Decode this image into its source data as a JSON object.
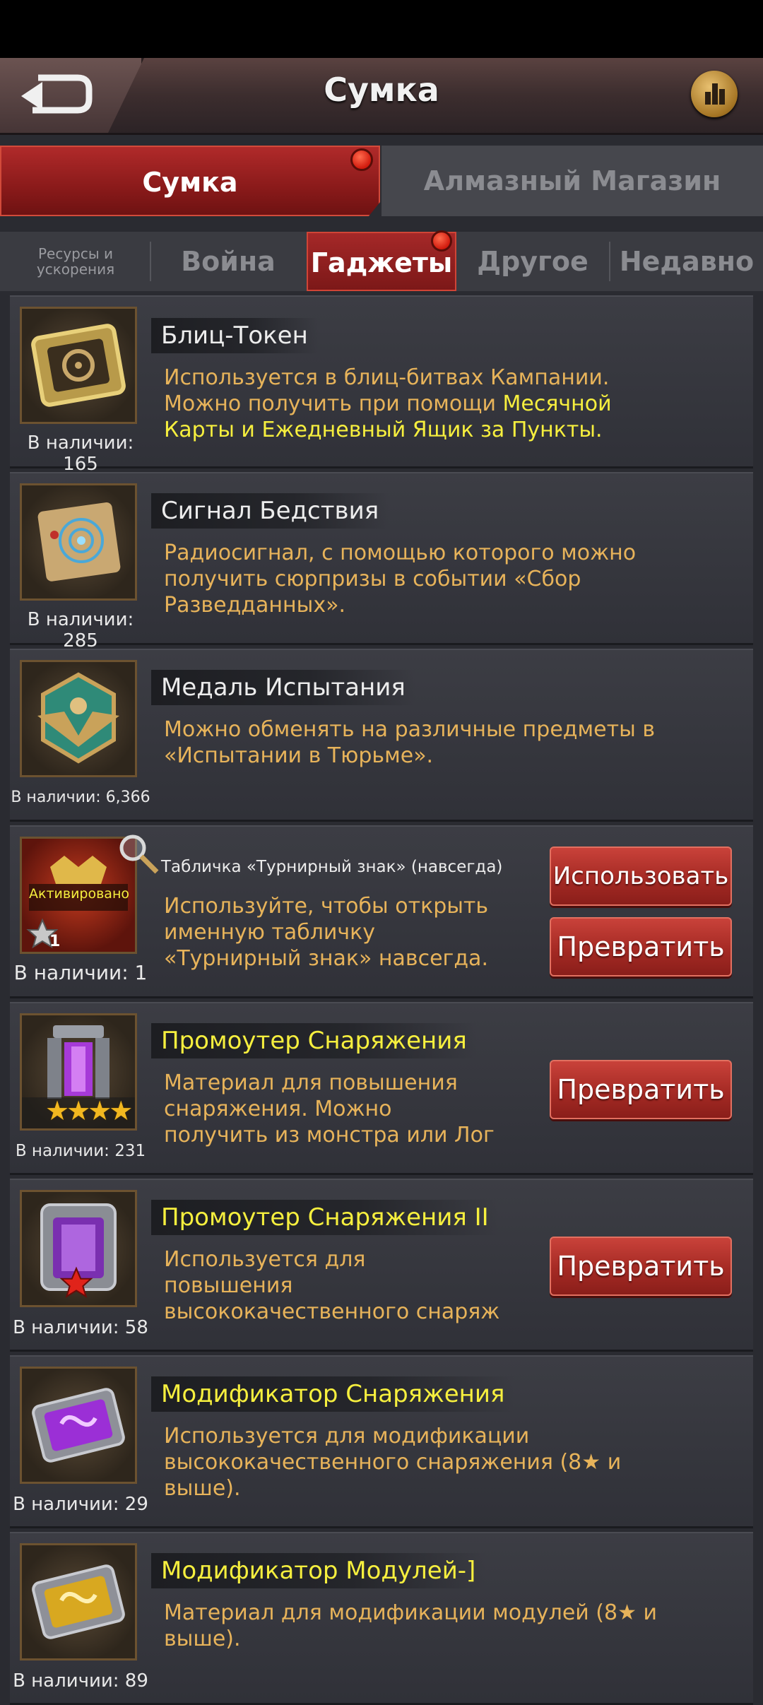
{
  "header": {
    "title": "Сумка",
    "back_icon": "back-arrow-icon",
    "stats_icon": "bar-chart-icon"
  },
  "main_tabs": [
    {
      "label": "Сумка",
      "active": true,
      "badge": true
    },
    {
      "label": "Алмазный Магазин",
      "active": false
    }
  ],
  "sub_tabs": [
    {
      "label": "Ресурсы и ускорения",
      "active": false
    },
    {
      "label": "Война",
      "active": false
    },
    {
      "label": "Гаджеты",
      "active": true,
      "badge": true
    },
    {
      "label": "Другое",
      "active": false
    },
    {
      "label": "Недавно",
      "active": false
    }
  ],
  "items": [
    {
      "name": "Блиц-Токен",
      "desc_line1": "Используется в блиц-битвах Кампании.",
      "desc_line2a": "Можно получить при помощи ",
      "desc_line2b": "Месячной",
      "desc_line3": "Карты и Ежедневный Ящик за Пункты.",
      "count": "В наличии: 165",
      "icon": "biohazard-tablet-icon"
    },
    {
      "name": "Сигнал Бедствия",
      "desc_lines": [
        "Радиосигнал, с помощью которого можно",
        "получить сюрпризы в событии «Сбор",
        "Разведданных»."
      ],
      "count": "В наличии: 285",
      "icon": "radar-scroll-icon"
    },
    {
      "name": "Медаль Испытания",
      "desc_lines": [
        "Можно обменять на различные предметы в",
        "«Испытании в Тюрьме»."
      ],
      "count": "В наличии: 6,366",
      "icon": "eagle-medal-icon"
    },
    {
      "name": "Табличка «Турнирный знак» (навсегда)",
      "desc_lines": [
        "Используйте, чтобы открыть",
        "именную табличку",
        "«Турнирный знак» навсегда."
      ],
      "count": "В наличии: 1",
      "activated": "Активировано",
      "star_level": "1",
      "icon": "tournament-plaque-icon",
      "buttons": [
        "Использовать",
        "Превратить"
      ]
    },
    {
      "name": "Промоутер Снаряжения",
      "desc_lines": [
        "Материал для повышения",
        "снаряжения. Можно",
        "получить из монстра или Лог"
      ],
      "count": "В наличии: 231",
      "icon": "gear-promoter-icon",
      "stars": 4,
      "buttons": [
        "Превратить"
      ]
    },
    {
      "name": "Промоутер Снаряжения II",
      "desc_lines": [
        "Используется для",
        "повышения",
        "высококачественного снаряж"
      ],
      "count": "В наличии: 58",
      "icon": "gear-promoter-ii-icon",
      "buttons": [
        "Превратить"
      ]
    },
    {
      "name": "Модификатор Снаряжения",
      "desc_lines": [
        "Используется для модификации",
        "высококачественного снаряжения (8★ и",
        "выше)."
      ],
      "count": "В наличии: 29",
      "icon": "purple-chip-icon"
    },
    {
      "name": "Модификатор Модулей-]",
      "desc_lines": [
        "Материал для модификации модулей (8★ и",
        "выше)."
      ],
      "count": "В наличии: 89",
      "icon": "gold-chip-icon"
    }
  ],
  "colors": {
    "accent_red": "#a52828",
    "desc_orange": "#e7b35a",
    "highlight_yellow": "#f6ef3e"
  }
}
